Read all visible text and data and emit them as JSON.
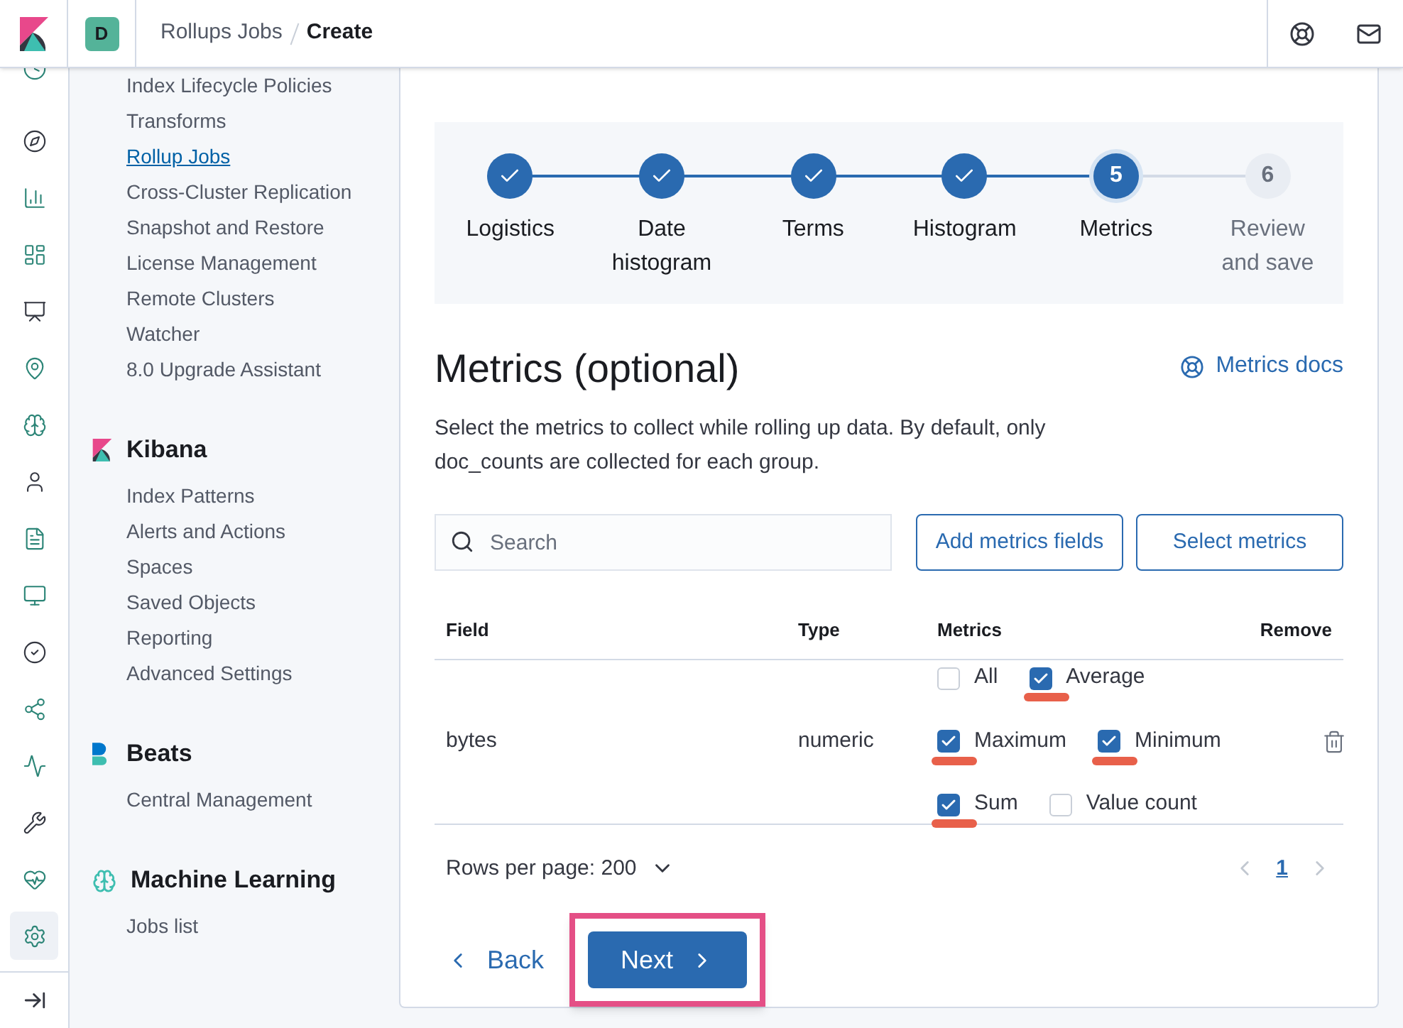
{
  "header": {
    "avatar": "D",
    "breadcrumbs": [
      {
        "label": "Rollups Jobs",
        "current": false
      },
      {
        "label": "Create",
        "current": true
      }
    ]
  },
  "rail": [
    {
      "selected": false
    },
    {
      "selected": false
    },
    {
      "selected": false
    },
    {
      "selected": false
    },
    {
      "selected": false
    },
    {
      "selected": false
    },
    {
      "selected": false
    },
    {
      "selected": false
    },
    {
      "selected": false
    },
    {
      "selected": false
    },
    {
      "selected": false
    },
    {
      "selected": false
    },
    {
      "selected": false
    },
    {
      "selected": false
    },
    {
      "selected": false
    },
    {
      "selected": true
    }
  ],
  "nav_groups": [
    {
      "kind": "plain",
      "items": [
        {
          "label": "Index Lifecycle Policies",
          "selected": false
        },
        {
          "label": "Transforms",
          "selected": false
        },
        {
          "label": "Rollup Jobs",
          "selected": true
        },
        {
          "label": "Cross-Cluster Replication",
          "selected": false
        },
        {
          "label": "Snapshot and Restore",
          "selected": false
        },
        {
          "label": "License Management",
          "selected": false
        },
        {
          "label": "Remote Clusters",
          "selected": false
        },
        {
          "label": "Watcher",
          "selected": false
        },
        {
          "label": "8.0 Upgrade Assistant",
          "selected": false
        }
      ]
    },
    {
      "kind": "kibana",
      "title": "Kibana",
      "items": [
        {
          "label": "Index Patterns",
          "selected": false
        },
        {
          "label": "Alerts and Actions",
          "selected": false
        },
        {
          "label": "Spaces",
          "selected": false
        },
        {
          "label": "Saved Objects",
          "selected": false
        },
        {
          "label": "Reporting",
          "selected": false
        },
        {
          "label": "Advanced Settings",
          "selected": false
        }
      ]
    },
    {
      "kind": "beats",
      "title": "Beats",
      "items": [
        {
          "label": "Central Management",
          "selected": false
        }
      ]
    },
    {
      "kind": "ml",
      "title": "Machine Learning",
      "items": [
        {
          "label": "Jobs list",
          "selected": false
        }
      ]
    }
  ],
  "steps": [
    {
      "label": "Logistics",
      "done": true,
      "selected": false
    },
    {
      "label": "Date histogram",
      "done": true,
      "selected": false
    },
    {
      "label": "Terms",
      "done": true,
      "selected": false
    },
    {
      "label": "Histogram",
      "done": true,
      "selected": false
    },
    {
      "label": "Metrics",
      "number": "5",
      "done": false,
      "selected": true
    },
    {
      "label": "Review and save",
      "number": "6",
      "done": false,
      "selected": false
    }
  ],
  "section": {
    "title": "Metrics (optional)",
    "docs_link": "Metrics docs",
    "description": "Select the metrics to collect while rolling up data. By default, only doc_counts are collected for each group."
  },
  "search": {
    "placeholder": "Search"
  },
  "buttons": [
    "Add metrics fields",
    "Select metrics"
  ],
  "table": {
    "columns": [
      "Field",
      "Type",
      "Metrics",
      "Remove"
    ],
    "rows": [
      {
        "field": "bytes",
        "type": "numeric",
        "metrics": [
          {
            "label": "All",
            "checked": false,
            "underlined": false
          },
          {
            "label": "Average",
            "checked": true,
            "underlined": true
          },
          {
            "label": "Maximum",
            "checked": true,
            "underlined": true
          },
          {
            "label": "Minimum",
            "checked": true,
            "underlined": true
          },
          {
            "label": "Sum",
            "checked": true,
            "underlined": true
          },
          {
            "label": "Value count",
            "checked": false,
            "underlined": false
          }
        ]
      }
    ]
  },
  "pagination": {
    "rows_per_page": "Rows per page: 200",
    "pages": [
      {
        "label": "1",
        "selected": true
      }
    ]
  },
  "actions": {
    "back": "Back",
    "next": {
      "label": "Next",
      "highlighted": true
    }
  }
}
